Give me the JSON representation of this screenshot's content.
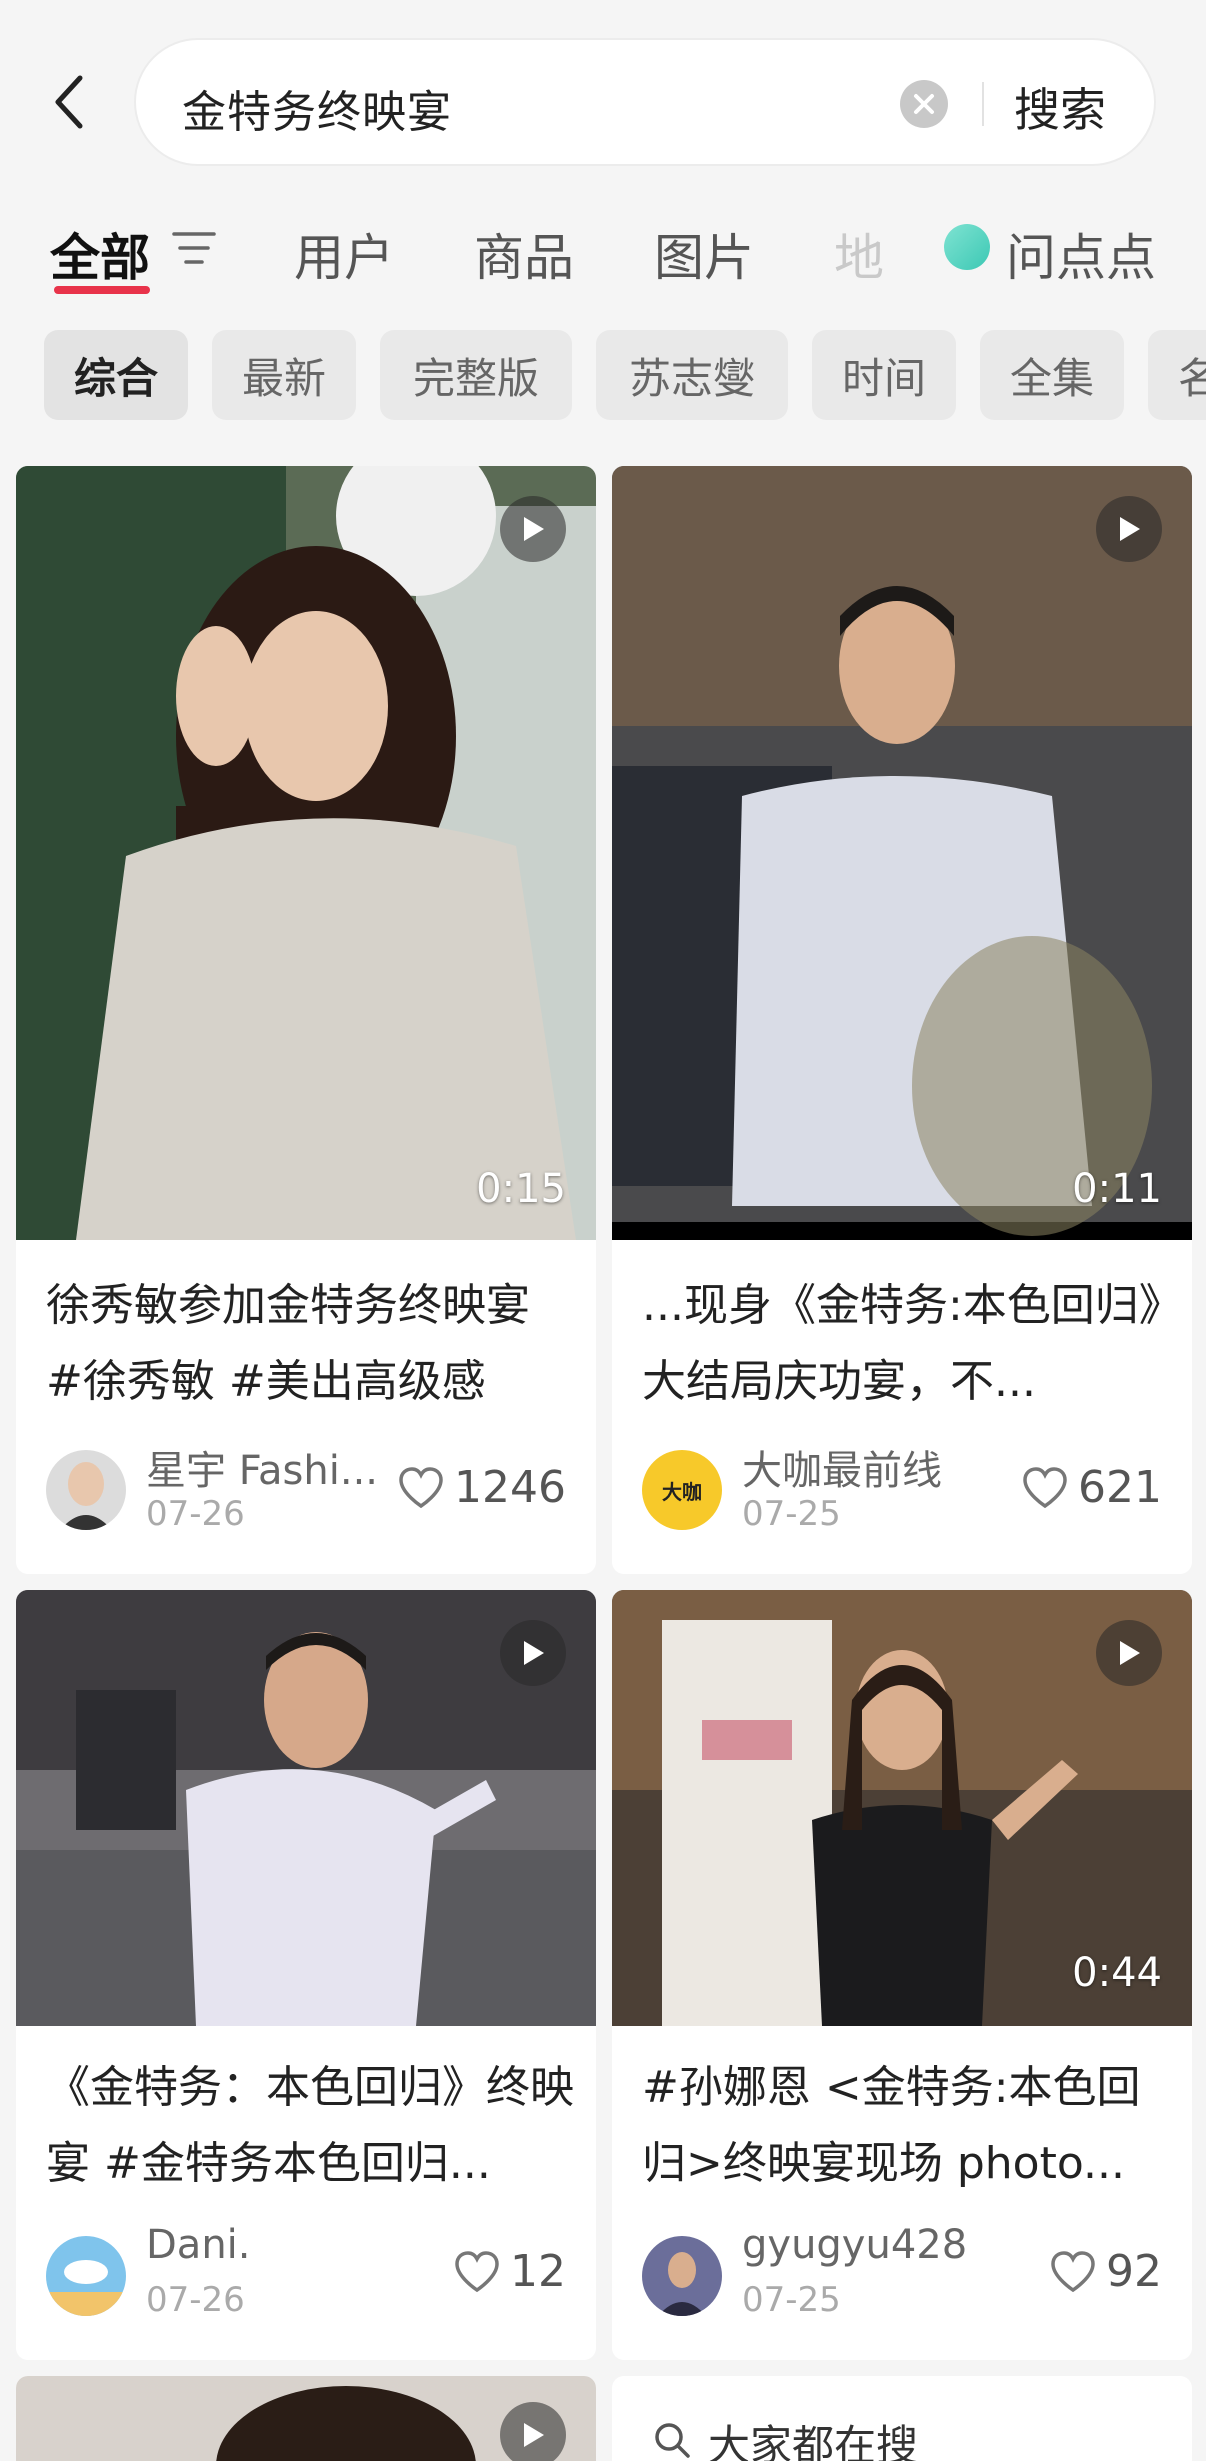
{
  "search": {
    "query": "金特务终映宴",
    "button_label": "搜索"
  },
  "tabs": [
    {
      "label": "全部"
    },
    {
      "label": "用户"
    },
    {
      "label": "商品"
    },
    {
      "label": "图片"
    },
    {
      "label": "地"
    },
    {
      "label": "问点点"
    }
  ],
  "chips": [
    "综合",
    "最新",
    "完整版",
    "苏志燮",
    "时间",
    "全集",
    "名"
  ],
  "cards": [
    {
      "title": "徐秀敏参加金特务终映宴 #徐秀敏 #美出高级感",
      "author": "星宇 Fashi...",
      "date": "07-26",
      "likes": "1246",
      "duration": "0:15"
    },
    {
      "title": "...现身《金特务:本色回归》大结局庆功宴，不...",
      "author": "大咖最前线",
      "date": "07-25",
      "likes": "621",
      "duration": "0:11",
      "avatar_text": "大咖"
    },
    {
      "title": "《金特务：本色回归》终映宴 #金特务本色回归...",
      "author": "Dani.",
      "date": "07-26",
      "likes": "12",
      "duration": ""
    },
    {
      "title": "#孙娜恩 <金特务:本色回归>终映宴现场 photo...",
      "author": "gyugyu428",
      "date": "07-25",
      "likes": "92",
      "duration": "0:44"
    }
  ],
  "trending": {
    "label": "大家都在搜"
  },
  "colors": {
    "accent": "#e8334a",
    "background": "#f5f5f5"
  }
}
